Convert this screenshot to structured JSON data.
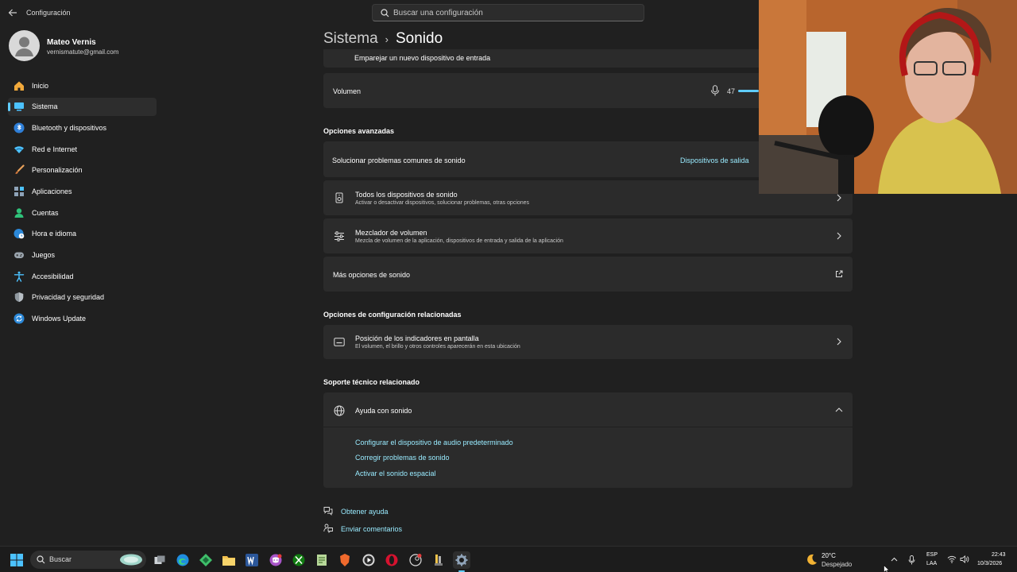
{
  "window": {
    "title": "Configuración",
    "search_placeholder": "Buscar una configuración"
  },
  "account": {
    "name": "Mateo Vernis",
    "email": "vernismatute@gmail.com"
  },
  "nav": [
    {
      "label": "Inicio",
      "icon": "home-icon",
      "active": false
    },
    {
      "label": "Sistema",
      "icon": "system-icon",
      "active": true
    },
    {
      "label": "Bluetooth y dispositivos",
      "icon": "bluetooth-icon",
      "active": false
    },
    {
      "label": "Red e Internet",
      "icon": "network-icon",
      "active": false
    },
    {
      "label": "Personalización",
      "icon": "brush-icon",
      "active": false
    },
    {
      "label": "Aplicaciones",
      "icon": "apps-icon",
      "active": false
    },
    {
      "label": "Cuentas",
      "icon": "accounts-icon",
      "active": false
    },
    {
      "label": "Hora e idioma",
      "icon": "globe-clock-icon",
      "active": false
    },
    {
      "label": "Juegos",
      "icon": "gamepad-icon",
      "active": false
    },
    {
      "label": "Accesibilidad",
      "icon": "accessibility-icon",
      "active": false
    },
    {
      "label": "Privacidad y seguridad",
      "icon": "shield-icon",
      "active": false
    },
    {
      "label": "Windows Update",
      "icon": "update-icon",
      "active": false
    }
  ],
  "breadcrumb": {
    "parent": "Sistema",
    "separator": "›",
    "current": "Sonido"
  },
  "input": {
    "pair_label": "Emparejar un nuevo dispositivo de entrada",
    "volume_label": "Volumen",
    "volume_value": "47"
  },
  "advanced": {
    "heading": "Opciones avanzadas",
    "troubleshoot_label": "Solucionar problemas comunes de sonido",
    "troubleshoot_button": "Dispositivos de salida",
    "all_devices_title": "Todos los dispositivos de sonido",
    "all_devices_sub": "Activar o desactivar dispositivos, solucionar problemas, otras opciones",
    "mixer_title": "Mezclador de volumen",
    "mixer_sub": "Mezcla de volumen de la aplicación, dispositivos de entrada y salida de la aplicación",
    "more_options": "Más opciones de sonido"
  },
  "related": {
    "heading": "Opciones de configuración relacionadas",
    "indicator_title": "Posición de los indicadores en pantalla",
    "indicator_sub": "El volumen, el brillo y otros controles aparecerán en esta ubicación"
  },
  "support": {
    "heading": "Soporte técnico relacionado",
    "help_title": "Ayuda con sonido",
    "links": [
      "Configurar el dispositivo de audio predeterminado",
      "Corregir problemas de sonido",
      "Activar el sonido espacial"
    ]
  },
  "footer": {
    "get_help": "Obtener ayuda",
    "feedback": "Enviar comentarios"
  },
  "taskbar": {
    "search_label": "Buscar",
    "weather_temp": "20°C",
    "weather_desc": "Despejado",
    "lang_top": "ESP",
    "lang_bottom": "LAA",
    "time": "22:43",
    "date": "10/3/2026"
  },
  "colors": {
    "accent": "#60cdff",
    "link": "#99ebff",
    "background": "#202020",
    "card": "#2b2b2b"
  }
}
